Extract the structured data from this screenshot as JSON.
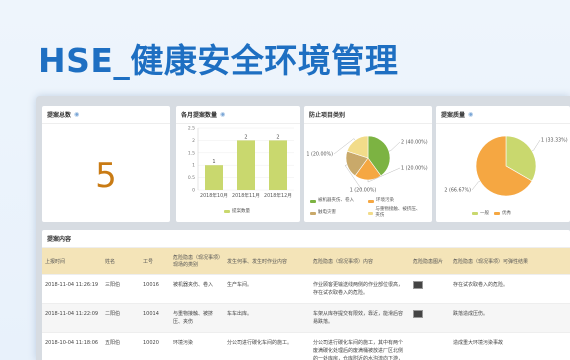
{
  "page_title": "HSE_健康安全环境管理",
  "cards": {
    "total": {
      "title": "提案总数",
      "value": "5"
    },
    "monthly": {
      "title": "各月提案数量",
      "legend": "提案数量",
      "chart_data": {
        "type": "bar",
        "categories": [
          "2018年10月",
          "2018年11月",
          "2018年12月"
        ],
        "values": [
          1,
          2,
          2
        ],
        "ylim": [
          0,
          2.5
        ],
        "yticks": [
          "0",
          "0.5",
          "1",
          "1.5",
          "2",
          "2.5"
        ]
      }
    },
    "category": {
      "title": "防止项目类别",
      "chart_data": {
        "type": "pie",
        "slices": [
          {
            "name": "被机器夹伤、卷入",
            "value": 2,
            "label": "2 (40.00%)",
            "color": "#7cb342"
          },
          {
            "name": "环境污染",
            "value": 1,
            "label": "1 (20.00%)",
            "color": "#f5a742"
          },
          {
            "name": "触电灾害",
            "value": 1,
            "label": "1 (20.00%)",
            "color": "#c9a96a"
          },
          {
            "name": "与重物接触、被挤压、夹伤",
            "value": 1,
            "label": "1 (20.00%)",
            "color": "#f2dc8a"
          }
        ]
      }
    },
    "level": {
      "title": "提案质量",
      "chart_data": {
        "type": "pie",
        "slices": [
          {
            "name": "一般",
            "value": 1,
            "label": "1 (33.33%)",
            "color": "#c9d86e"
          },
          {
            "name": "优秀",
            "value": 2,
            "label": "2 (66.67%)",
            "color": "#f5a742"
          }
        ]
      }
    }
  },
  "table": {
    "title": "提案内容",
    "headers": [
      "上报时间",
      "姓名",
      "工号",
      "危险隐患（现况事项）现场的类别",
      "发生何事、发生时作业内容",
      "危险隐患（现况事项）内容",
      "危险隐患图片",
      "危险隐患（现况事项）可弹性结果"
    ],
    "rows": [
      {
        "time": "2018-11-04 11:26:19",
        "name": "三阳伯",
        "id": "10016",
        "category": "被机器夹伤、卷入",
        "what": "生产车间。",
        "content": "作业顾客更输送线两侧的作业部位很高，存在试衣取卷入的危险。",
        "result": "存在试衣取卷入的危险。"
      },
      {
        "time": "2018-11-04 11:22:09",
        "name": "二阳伯",
        "id": "10014",
        "category": "与重物接触、被挤压、夹伤",
        "what": "车车出库。",
        "content": "车架从库存提交有限效，靠近，能滑后容易跌落。",
        "result": "跌落造成压伤。"
      },
      {
        "time": "2018-10-04 11:18:06",
        "name": "五阳伯",
        "id": "10020",
        "category": "环境污染",
        "what": "分公司进行碳化车间的施工。",
        "content": "分公司进行碳化车间的施工，其中有两个废满碳化处理后的废满桶被放进厂区北侧的一处库房，仓库附近的水沟流向下游，存在严重环境污染隐患。",
        "result": "造成重大环境污染事故"
      }
    ]
  }
}
